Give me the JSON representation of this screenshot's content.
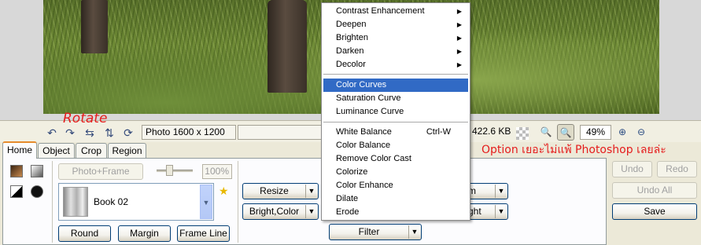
{
  "toolbar": {
    "rotate_annotation": "Rotate",
    "photo_info": "Photo 1600 x 1200",
    "file_size": "422.6 KB",
    "zoom_value": "49%",
    "icons": [
      "undo-rotate-icon",
      "redo-rotate-icon",
      "flip-horizontal-icon",
      "flip-vertical-icon",
      "rotate-free-icon"
    ]
  },
  "tabs": [
    "Home",
    "Object",
    "Crop",
    "Region"
  ],
  "home_panel": {
    "photo_frame_label": "Photo+Frame",
    "frame_opacity": "100%",
    "frame_name": "Book 02",
    "round_label": "Round",
    "margin_label": "Margin",
    "frame_line_label": "Frame Line",
    "resize_label": "Resize",
    "bright_color_label": "Bright,Color",
    "filter_label": "Filter",
    "partial_dd1": "m",
    "partial_dd2": "ght"
  },
  "right_panel": {
    "undo_label": "Undo",
    "redo_label": "Redo",
    "undo_all_label": "Undo All",
    "save_label": "Save"
  },
  "annotation": {
    "option_note": "Option เยอะไม่แพ้ Photoshop เลยล่ะ"
  },
  "menu": {
    "items": [
      {
        "label": "Contrast Enhancement",
        "submenu": true
      },
      {
        "label": "Deepen",
        "submenu": true
      },
      {
        "label": "Brighten",
        "submenu": true
      },
      {
        "label": "Darken",
        "submenu": true
      },
      {
        "label": "Decolor",
        "submenu": true
      },
      {
        "label": "Color Curves",
        "selected": true
      },
      {
        "label": "Saturation Curve"
      },
      {
        "label": "Luminance Curve"
      },
      {
        "label": "White Balance",
        "shortcut": "Ctrl-W"
      },
      {
        "label": "Color Balance"
      },
      {
        "label": "Remove Color Cast"
      },
      {
        "label": "Colorize"
      },
      {
        "label": "Color Enhance"
      },
      {
        "label": "Dilate"
      },
      {
        "label": "Erode"
      }
    ]
  },
  "colors": {
    "annotation_red": "#e51c1c",
    "menu_highlight": "#316ac5",
    "tab_active_accent": "#e68b2c"
  }
}
